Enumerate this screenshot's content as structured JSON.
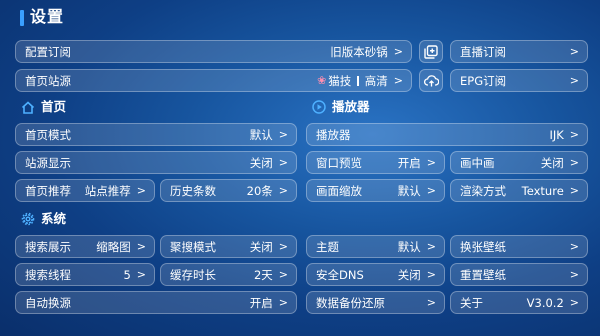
{
  "page": {
    "title": "设置"
  },
  "top_rows": {
    "subscription": {
      "label": "配置订阅",
      "value": "旧版本砂锅",
      "chevron": ">"
    },
    "live_subscription": {
      "label": "直播订阅",
      "chevron": ">"
    },
    "home_source": {
      "label": "首页站源",
      "value_a": "猫技",
      "value_b": "高清",
      "chevron": ">"
    },
    "epg_subscription": {
      "label": "EPG订阅",
      "chevron": ">"
    }
  },
  "sections": {
    "home": {
      "title": "首页",
      "icon": "home-icon"
    },
    "player": {
      "title": "播放器",
      "icon": "play-circle-icon"
    },
    "system": {
      "title": "系统",
      "icon": "gear-icon"
    }
  },
  "home_settings": {
    "home_mode": {
      "label": "首页模式",
      "value": "默认",
      "chevron": ">"
    },
    "source_display": {
      "label": "站源显示",
      "value": "关闭",
      "chevron": ">"
    },
    "home_recommend": {
      "label": "首页推荐",
      "value": "站点推荐",
      "chevron": ">"
    },
    "history_count": {
      "label": "历史条数",
      "value": "20条",
      "chevron": ">"
    }
  },
  "player_settings": {
    "player": {
      "label": "播放器",
      "value": "IJK",
      "chevron": ">"
    },
    "window_preview": {
      "label": "窗口预览",
      "value": "开启",
      "chevron": ">"
    },
    "pip": {
      "label": "画中画",
      "value": "关闭",
      "chevron": ">"
    },
    "zoom": {
      "label": "画面缩放",
      "value": "默认",
      "chevron": ">"
    },
    "render": {
      "label": "渲染方式",
      "value": "Texture",
      "chevron": ">"
    }
  },
  "system_settings": {
    "search_display": {
      "label": "搜索展示",
      "value": "缩略图",
      "chevron": ">"
    },
    "aggregate_search": {
      "label": "聚搜模式",
      "value": "关闭",
      "chevron": ">"
    },
    "search_threads": {
      "label": "搜索线程",
      "value": "5",
      "chevron": ">"
    },
    "cache_duration": {
      "label": "缓存时长",
      "value": "2天",
      "chevron": ">"
    },
    "auto_switch": {
      "label": "自动换源",
      "value": "开启",
      "chevron": ">"
    },
    "theme": {
      "label": "主题",
      "value": "默认",
      "chevron": ">"
    },
    "change_wallpaper": {
      "label": "换张壁纸",
      "chevron": ">"
    },
    "secure_dns": {
      "label": "安全DNS",
      "value": "关闭",
      "chevron": ">"
    },
    "reset_wallpaper": {
      "label": "重置壁纸",
      "chevron": ">"
    },
    "backup_restore": {
      "label": "数据备份还原",
      "chevron": ">"
    },
    "about": {
      "label": "关于",
      "value": "V3.0.2",
      "chevron": ">"
    }
  },
  "icons": {
    "add_button": "add-box-icon",
    "upload_button": "cloud-upload-icon",
    "flower": "flower-icon"
  },
  "colors": {
    "accent": "#3aa0ff",
    "flower": "#ff8fb0"
  }
}
